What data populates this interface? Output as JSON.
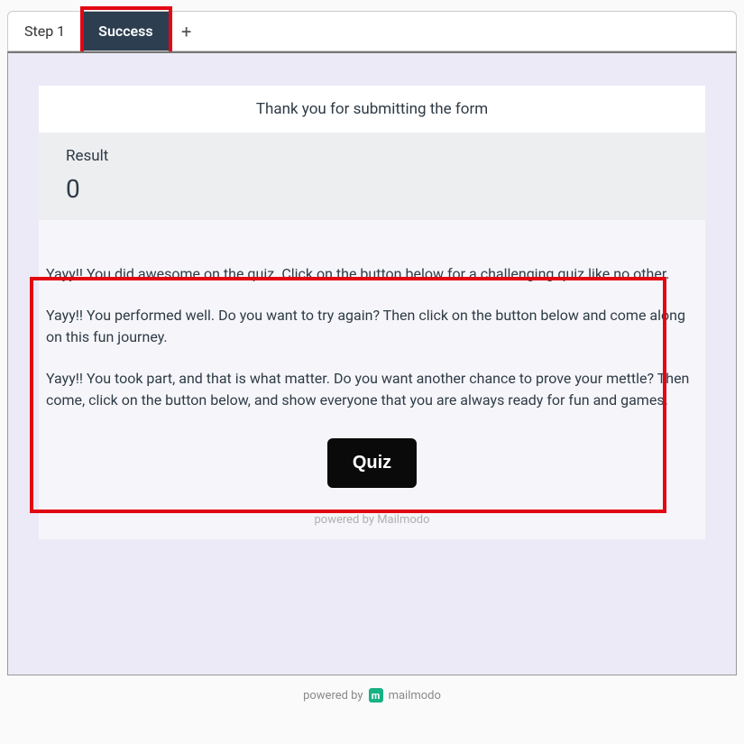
{
  "tabs": {
    "step1": "Step 1",
    "success": "Success"
  },
  "thankyou": "Thank you for submitting the form",
  "result": {
    "label": "Result",
    "value": "0"
  },
  "messages": {
    "m1": "Yayy!! You did awesome on the quiz. Click on the button below for a challenging quiz like no other.",
    "m2": "Yayy!! You performed well. Do you want to try again? Then click on the button below and come along on this fun journey.",
    "m3": "Yayy!! You took part, and that is what matter. Do you want another chance to prove your mettle? Then come, click on the button below, and show everyone that you are always ready for fun and games."
  },
  "button": {
    "quiz": "Quiz"
  },
  "powered_inline": "powered by Mailmodo",
  "footer": {
    "prefix": "powered by",
    "brand": "mailmodo",
    "logo_letter": "m"
  }
}
